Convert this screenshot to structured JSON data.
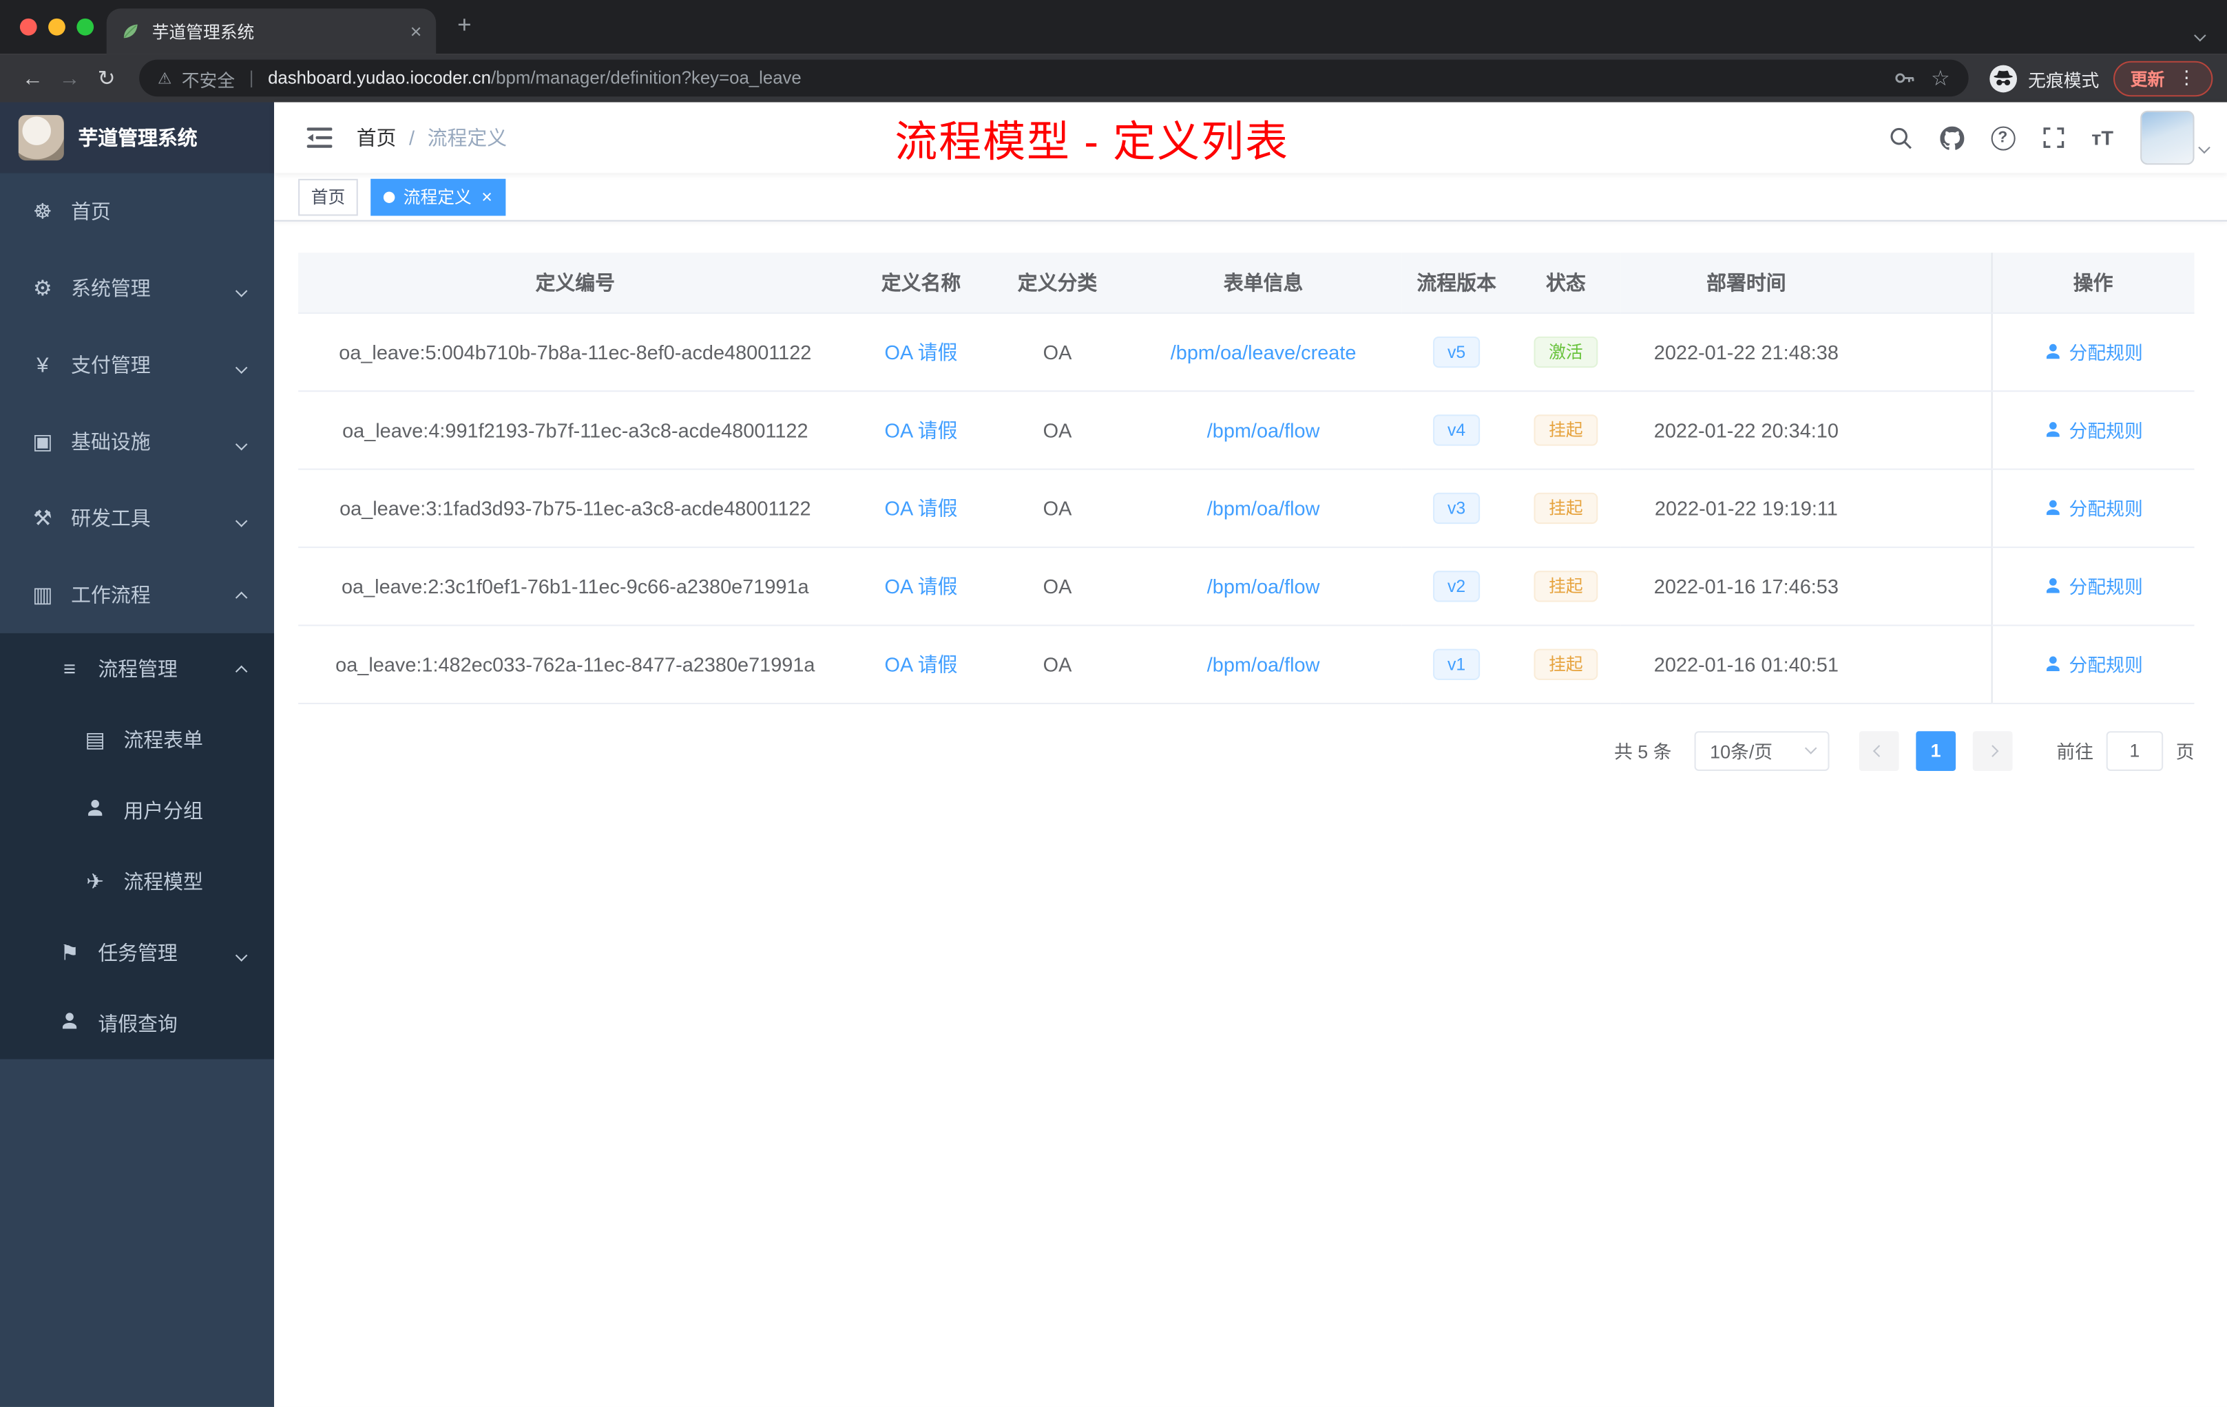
{
  "browser": {
    "tab_title": "芋道管理系统",
    "security_label": "不安全",
    "url_host": "dashboard.yudao.iocoder.cn",
    "url_path": "/bpm/manager/definition?key=oa_leave",
    "incognito_label": "无痕模式",
    "update_label": "更新"
  },
  "icons": {
    "back": "←",
    "forward": "→",
    "reload": "↻",
    "warning": "⚠",
    "star": "☆",
    "menu_dots": "⋮",
    "new_tab": "+",
    "close": "×",
    "question": "?",
    "font_size": "тT"
  },
  "sidebar": {
    "title": "芋道管理系统",
    "items": [
      {
        "label": "首页",
        "icon": "☸"
      },
      {
        "label": "系统管理",
        "icon": "⚙"
      },
      {
        "label": "支付管理",
        "icon": "¥"
      },
      {
        "label": "基础设施",
        "icon": "▣"
      },
      {
        "label": "研发工具",
        "icon": "⚒"
      },
      {
        "label": "工作流程",
        "icon": "▥"
      },
      {
        "label": "流程管理",
        "icon": "≡"
      },
      {
        "label": "流程表单",
        "icon": "▤"
      },
      {
        "label": "用户分组",
        "icon": ""
      },
      {
        "label": "流程模型",
        "icon": "✈"
      },
      {
        "label": "任务管理",
        "icon": "⚑"
      },
      {
        "label": "请假查询",
        "icon": ""
      }
    ]
  },
  "header": {
    "breadcrumb_home": "首页",
    "breadcrumb_sep": "/",
    "breadcrumb_current": "流程定义",
    "annotation": "流程模型 - 定义列表"
  },
  "tags": {
    "home": "首页",
    "active": "流程定义"
  },
  "table": {
    "columns": [
      "定义编号",
      "定义名称",
      "定义分类",
      "表单信息",
      "流程版本",
      "状态",
      "部署时间",
      "操作"
    ],
    "rows": [
      {
        "id": "oa_leave:5:004b710b-7b8a-11ec-8ef0-acde48001122",
        "name": "OA 请假",
        "category": "OA",
        "form": "/bpm/oa/leave/create",
        "version": "v5",
        "status": "激活",
        "time": "2022-01-22 21:48:38",
        "action": "分配规则"
      },
      {
        "id": "oa_leave:4:991f2193-7b7f-11ec-a3c8-acde48001122",
        "name": "OA 请假",
        "category": "OA",
        "form": "/bpm/oa/flow",
        "version": "v4",
        "status": "挂起",
        "time": "2022-01-22 20:34:10",
        "action": "分配规则"
      },
      {
        "id": "oa_leave:3:1fad3d93-7b75-11ec-a3c8-acde48001122",
        "name": "OA 请假",
        "category": "OA",
        "form": "/bpm/oa/flow",
        "version": "v3",
        "status": "挂起",
        "time": "2022-01-22 19:19:11",
        "action": "分配规则"
      },
      {
        "id": "oa_leave:2:3c1f0ef1-76b1-11ec-9c66-a2380e71991a",
        "name": "OA 请假",
        "category": "OA",
        "form": "/bpm/oa/flow",
        "version": "v2",
        "status": "挂起",
        "time": "2022-01-16 17:46:53",
        "action": "分配规则"
      },
      {
        "id": "oa_leave:1:482ec033-762a-11ec-8477-a2380e71991a",
        "name": "OA 请假",
        "category": "OA",
        "form": "/bpm/oa/flow",
        "version": "v1",
        "status": "挂起",
        "time": "2022-01-16 01:40:51",
        "action": "分配规则"
      }
    ]
  },
  "pagination": {
    "total": "共 5 条",
    "page_size": "10条/页",
    "current_page": "1",
    "goto_label": "前往",
    "goto_value": "1",
    "page_unit": "页"
  },
  "colors": {
    "accent": "#409eff",
    "success": "#67c23a",
    "warning": "#e6a23c",
    "annotation_red": "#fe0000",
    "sidebar_bg": "#304156",
    "submenu_bg": "#1f2d3d"
  }
}
